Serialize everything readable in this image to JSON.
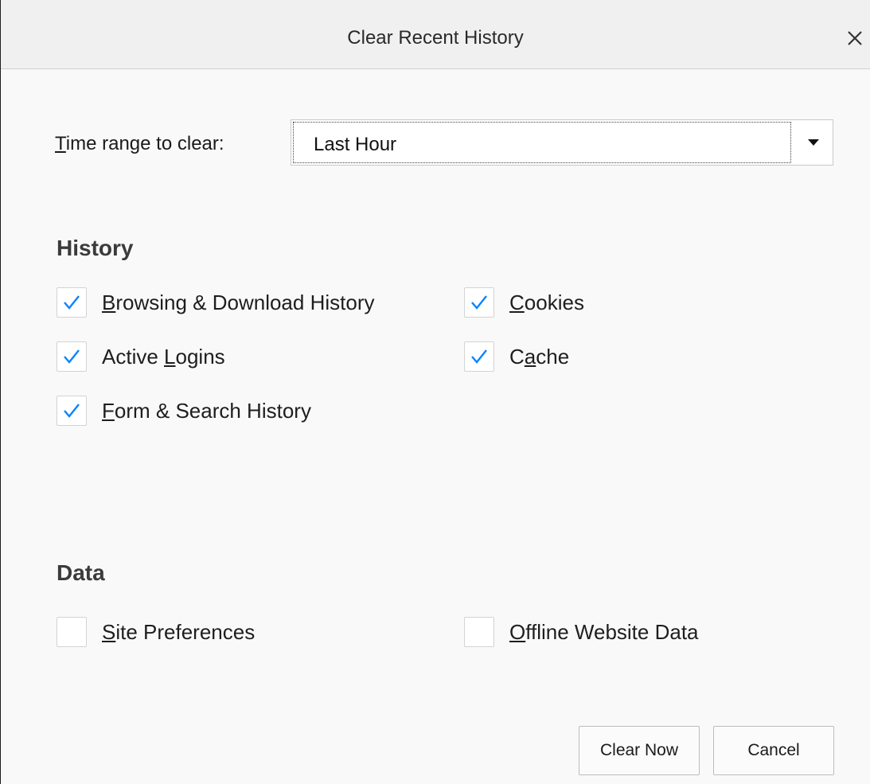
{
  "dialog": {
    "title": "Clear Recent History"
  },
  "time_range": {
    "label_accesskey": "T",
    "label_rest": "ime range to clear:",
    "selected": "Last Hour"
  },
  "history": {
    "heading": "History",
    "items": [
      {
        "pre": "",
        "key": "B",
        "post": "rowsing & Download History",
        "checked": true
      },
      {
        "pre": "",
        "key": "C",
        "post": "ookies",
        "checked": true
      },
      {
        "pre": "Active ",
        "key": "L",
        "post": "ogins",
        "checked": true
      },
      {
        "pre": "C",
        "key": "a",
        "post": "che",
        "checked": true
      },
      {
        "pre": "",
        "key": "F",
        "post": "orm & Search History",
        "checked": true
      }
    ]
  },
  "data_section": {
    "heading": "Data",
    "items": [
      {
        "pre": "",
        "key": "S",
        "post": "ite Preferences",
        "checked": false
      },
      {
        "pre": "",
        "key": "O",
        "post": "ffline Website Data",
        "checked": false
      }
    ]
  },
  "buttons": {
    "clear_now": "Clear Now",
    "cancel": "Cancel"
  },
  "colors": {
    "checkmark": "#0a84ff",
    "background": "#f9f9fa"
  }
}
